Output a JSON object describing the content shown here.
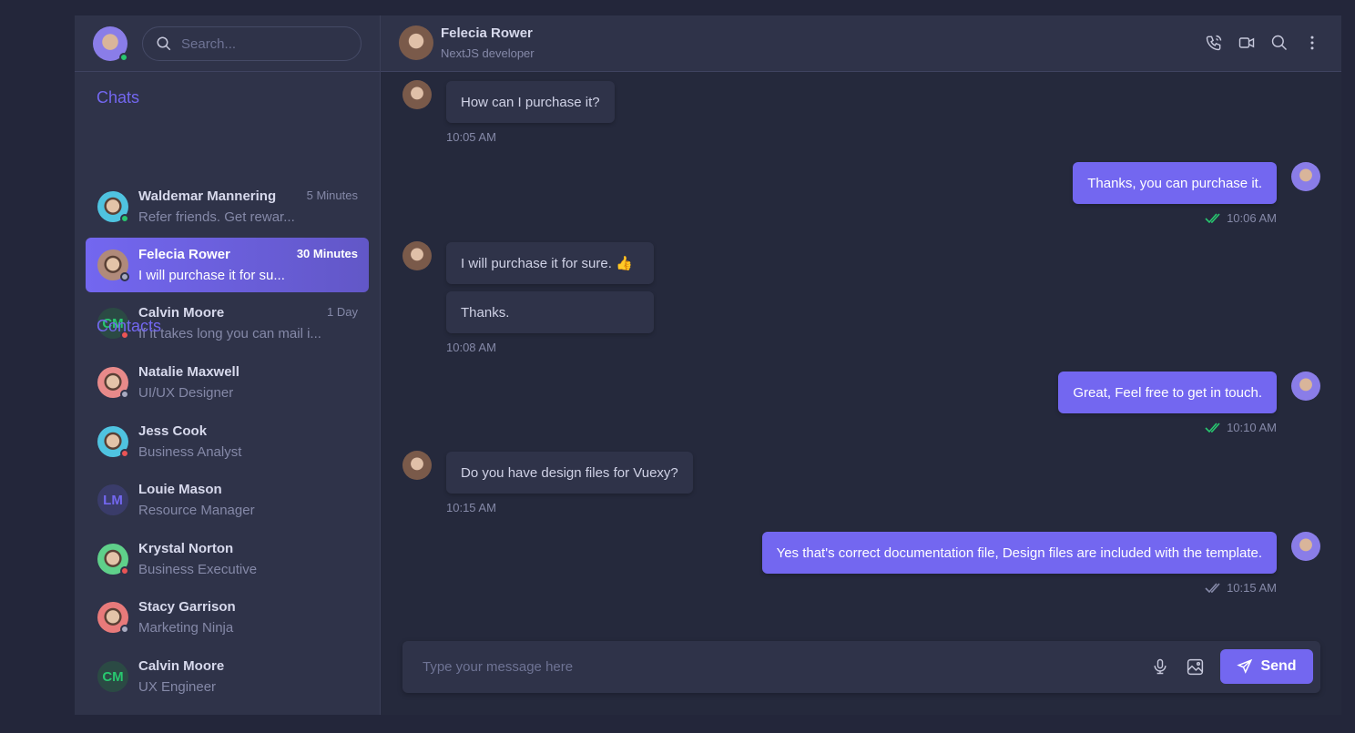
{
  "search": {
    "placeholder": "Search..."
  },
  "sections": {
    "chats": "Chats",
    "contacts": "Contacts"
  },
  "chats": [
    {
      "name": "Waldemar Mannering",
      "preview": "Refer friends. Get rewar...",
      "time": "5 Minutes",
      "status": "online",
      "avatar_color": "#4fc3e0"
    },
    {
      "name": "Felecia Rower",
      "preview": "I will purchase it for su...",
      "time": "30 Minutes",
      "status": "offline",
      "avatar_color": "#b08a7a",
      "active": true
    },
    {
      "name": "Calvin Moore",
      "preview": "If it takes long you can mail i...",
      "time": "1 Day",
      "status": "busy",
      "initials": "CM"
    }
  ],
  "contacts": [
    {
      "name": "Natalie Maxwell",
      "role": "UI/UX Designer",
      "status": "offline",
      "avatar_color": "#e88a8a"
    },
    {
      "name": "Jess Cook",
      "role": "Business Analyst",
      "status": "busy",
      "avatar_color": "#4fc3e0"
    },
    {
      "name": "Louie Mason",
      "role": "Resource Manager",
      "initials": "LM"
    },
    {
      "name": "Krystal Norton",
      "role": "Business Executive",
      "status": "busy",
      "avatar_color": "#5fd08a"
    },
    {
      "name": "Stacy Garrison",
      "role": "Marketing Ninja",
      "status": "offline",
      "avatar_color": "#e87a7a"
    },
    {
      "name": "Calvin Moore",
      "role": "UX Engineer",
      "initials": "CM"
    }
  ],
  "header": {
    "name": "Felecia Rower",
    "role": "NextJS developer"
  },
  "messages": [
    {
      "side": "in",
      "texts": [
        "How can I purchase it?"
      ],
      "time": "10:05 AM"
    },
    {
      "side": "out",
      "texts": [
        "Thanks, you can purchase it."
      ],
      "time": "10:06 AM",
      "read": true
    },
    {
      "side": "in",
      "texts": [
        "I will purchase it for sure. 👍",
        "Thanks."
      ],
      "time": "10:08 AM"
    },
    {
      "side": "out",
      "texts": [
        "Great, Feel free to get in touch."
      ],
      "time": "10:10 AM",
      "read": true
    },
    {
      "side": "in",
      "texts": [
        "Do you have design files for Vuexy?"
      ],
      "time": "10:15 AM"
    },
    {
      "side": "out",
      "texts": [
        "Yes that's correct documentation file, Design files are included with the template."
      ],
      "time": "10:15 AM",
      "read": false
    }
  ],
  "composer": {
    "placeholder": "Type your message here",
    "send_label": "Send"
  },
  "colors": {
    "accent": "#7367f0",
    "online": "#28c76f",
    "busy": "#ea5455",
    "offline": "#a8aac0"
  }
}
